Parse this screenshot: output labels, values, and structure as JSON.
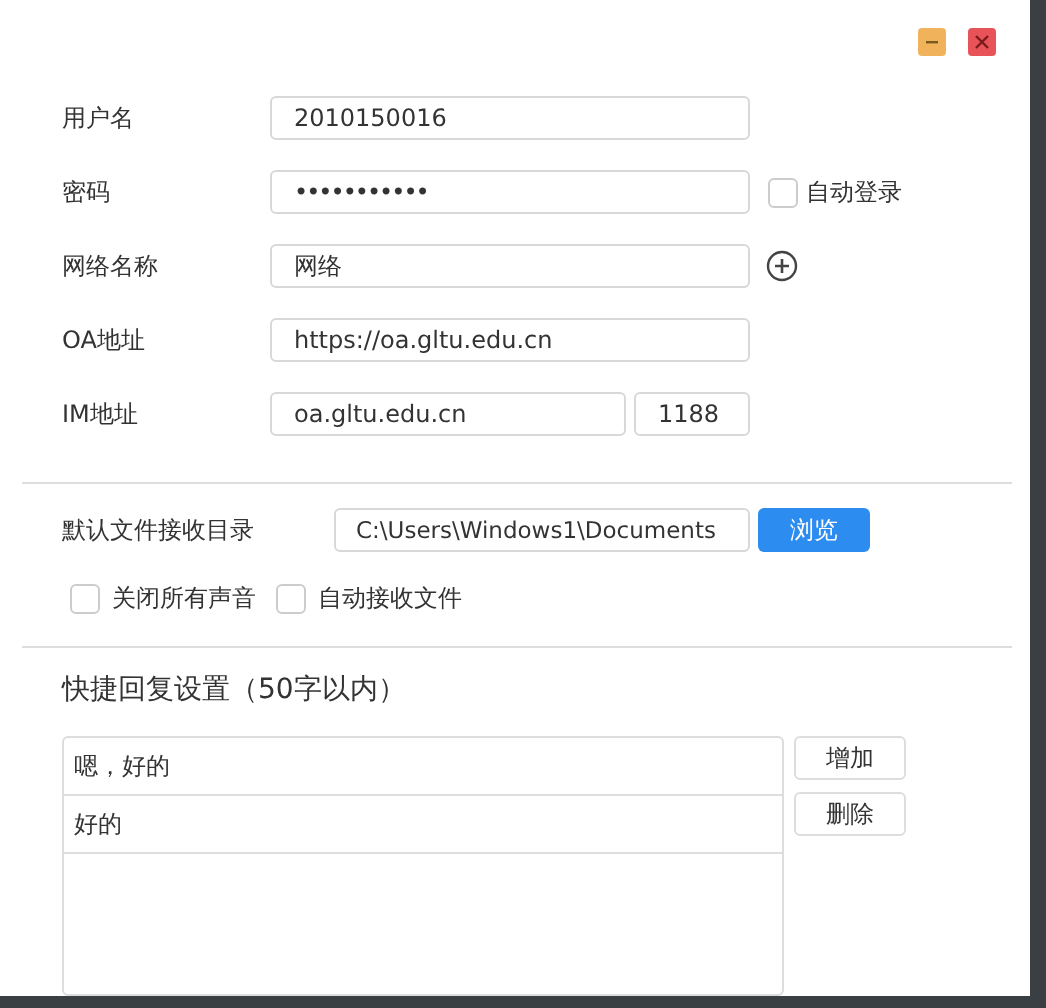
{
  "window_controls": [
    {
      "kind": "minimize"
    },
    {
      "kind": "close"
    }
  ],
  "login_form": [
    {
      "label": "用户名",
      "value": "2010150016",
      "kind": "text"
    },
    {
      "label": "密码",
      "value": "•••••••••••",
      "kind": "password",
      "checkbox": {
        "label": "自动登录",
        "checked": false
      }
    },
    {
      "label": "网络名称",
      "value": "网络",
      "kind": "network"
    },
    {
      "label": "OA地址",
      "value": "https://oa.gltu.edu.cn",
      "kind": "text"
    },
    {
      "label": "IM地址",
      "value": "oa.gltu.edu.cn",
      "port": "1188",
      "kind": "host"
    }
  ],
  "file_settings": {
    "label": "默认文件接收目录",
    "path": "C:\\Users\\Windows1\\Documents",
    "browse_button": "浏览",
    "options": [
      {
        "label": "关闭所有声音",
        "checked": false
      },
      {
        "label": "自动接收文件",
        "checked": false
      }
    ]
  },
  "quick_reply": {
    "title": "快捷回复设置（50字以内）",
    "items": [
      "嗯，好的",
      "好的"
    ],
    "buttons": [
      "增加",
      "删除"
    ]
  }
}
